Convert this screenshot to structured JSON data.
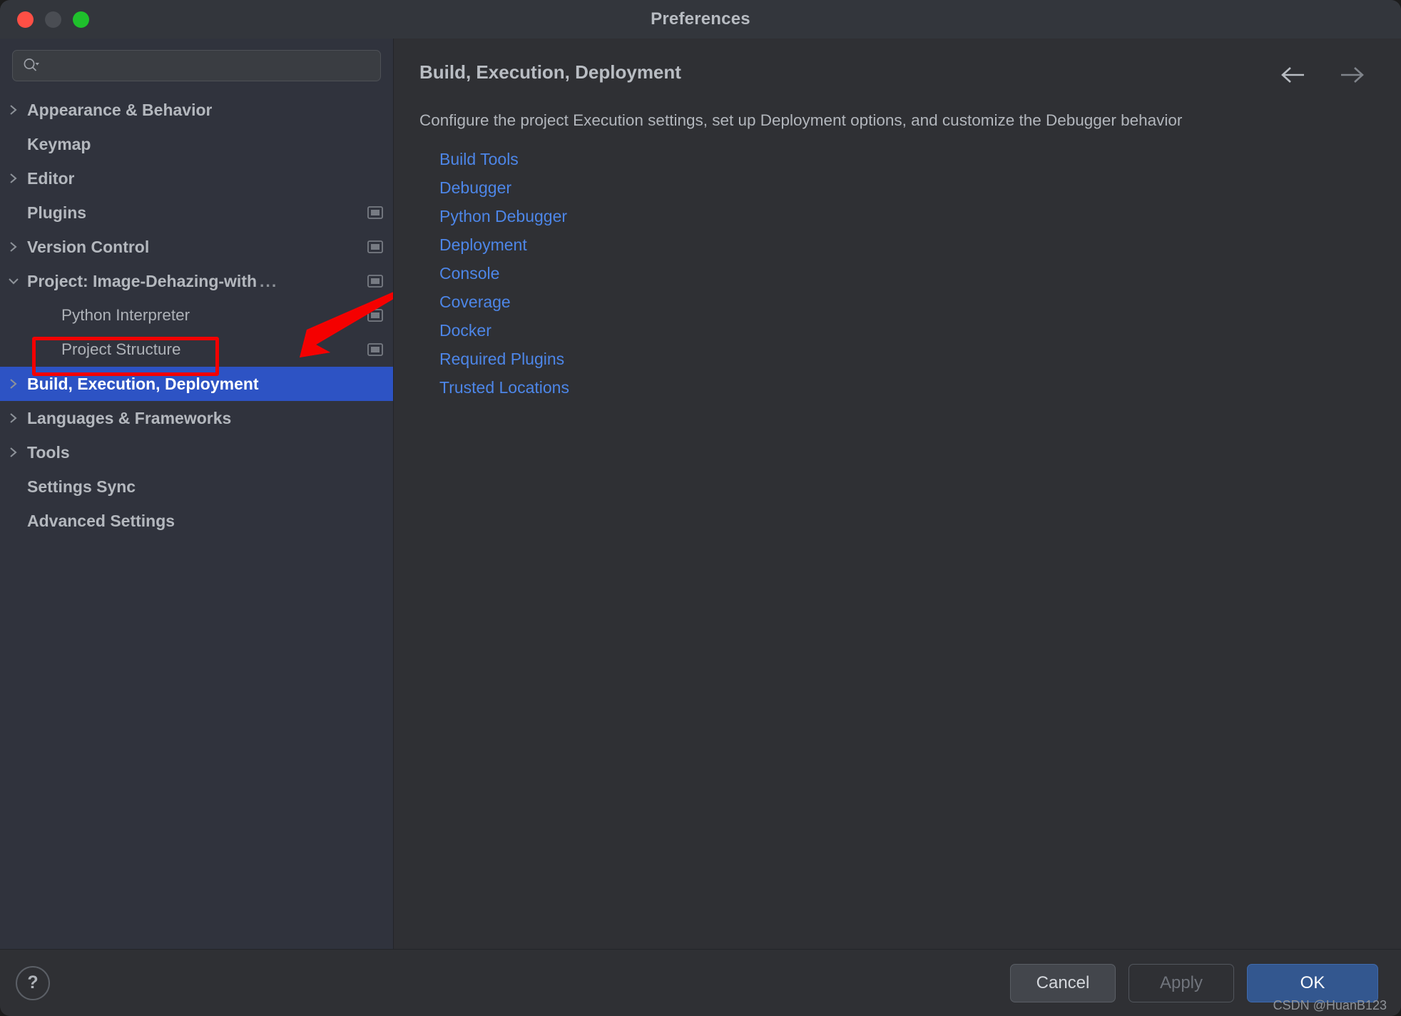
{
  "window": {
    "title": "Preferences",
    "traffic_lights": [
      "close",
      "minimize",
      "zoom"
    ]
  },
  "search": {
    "placeholder": "",
    "value": "",
    "icon": "search-icon"
  },
  "sidebar": {
    "items": [
      {
        "label": "Appearance & Behavior",
        "twisty": "collapsed",
        "level": 0,
        "trailing": "none",
        "selected": false
      },
      {
        "label": "Keymap",
        "twisty": "none",
        "level": 0,
        "trailing": "none",
        "selected": false
      },
      {
        "label": "Editor",
        "twisty": "collapsed",
        "level": 0,
        "trailing": "none",
        "selected": false
      },
      {
        "label": "Plugins",
        "twisty": "none",
        "level": 0,
        "trailing": "screen-icon",
        "selected": false
      },
      {
        "label": "Version Control",
        "twisty": "collapsed",
        "level": 0,
        "trailing": "screen-icon",
        "selected": false
      },
      {
        "label": "Project: Image-Dehazing-with",
        "twisty": "expanded",
        "level": 0,
        "trailing": "screen-icon",
        "selected": false,
        "truncated": true,
        "ellipsis": "..."
      },
      {
        "label": "Python Interpreter",
        "twisty": "none",
        "level": 1,
        "trailing": "screen-icon",
        "selected": false,
        "highlighted": true
      },
      {
        "label": "Project Structure",
        "twisty": "none",
        "level": 1,
        "trailing": "screen-icon",
        "selected": false
      },
      {
        "label": "Build, Execution, Deployment",
        "twisty": "collapsed",
        "level": 0,
        "trailing": "none",
        "selected": true
      },
      {
        "label": "Languages & Frameworks",
        "twisty": "collapsed",
        "level": 0,
        "trailing": "none",
        "selected": false
      },
      {
        "label": "Tools",
        "twisty": "collapsed",
        "level": 0,
        "trailing": "none",
        "selected": false
      },
      {
        "label": "Settings Sync",
        "twisty": "none",
        "level": 0,
        "trailing": "none",
        "selected": false
      },
      {
        "label": "Advanced Settings",
        "twisty": "none",
        "level": 0,
        "trailing": "none",
        "selected": false
      }
    ]
  },
  "main": {
    "title": "Build, Execution, Deployment",
    "description": "Configure the project Execution settings, set up Deployment options, and customize the Debugger behavior",
    "nav": {
      "back": "back-arrow",
      "forward": "forward-arrow"
    },
    "links": [
      "Build Tools",
      "Debugger",
      "Python Debugger",
      "Deployment",
      "Console",
      "Coverage",
      "Docker",
      "Required Plugins",
      "Trusted Locations"
    ]
  },
  "footer": {
    "help_label": "?",
    "cancel_label": "Cancel",
    "apply_label": "Apply",
    "ok_label": "OK",
    "watermark": "CSDN @HuanB123"
  },
  "annotations": {
    "highlight_color": "#f50000",
    "arrow_color": "#f50000",
    "selected_color": "#2d53c4",
    "link_color": "#4d86e8"
  }
}
